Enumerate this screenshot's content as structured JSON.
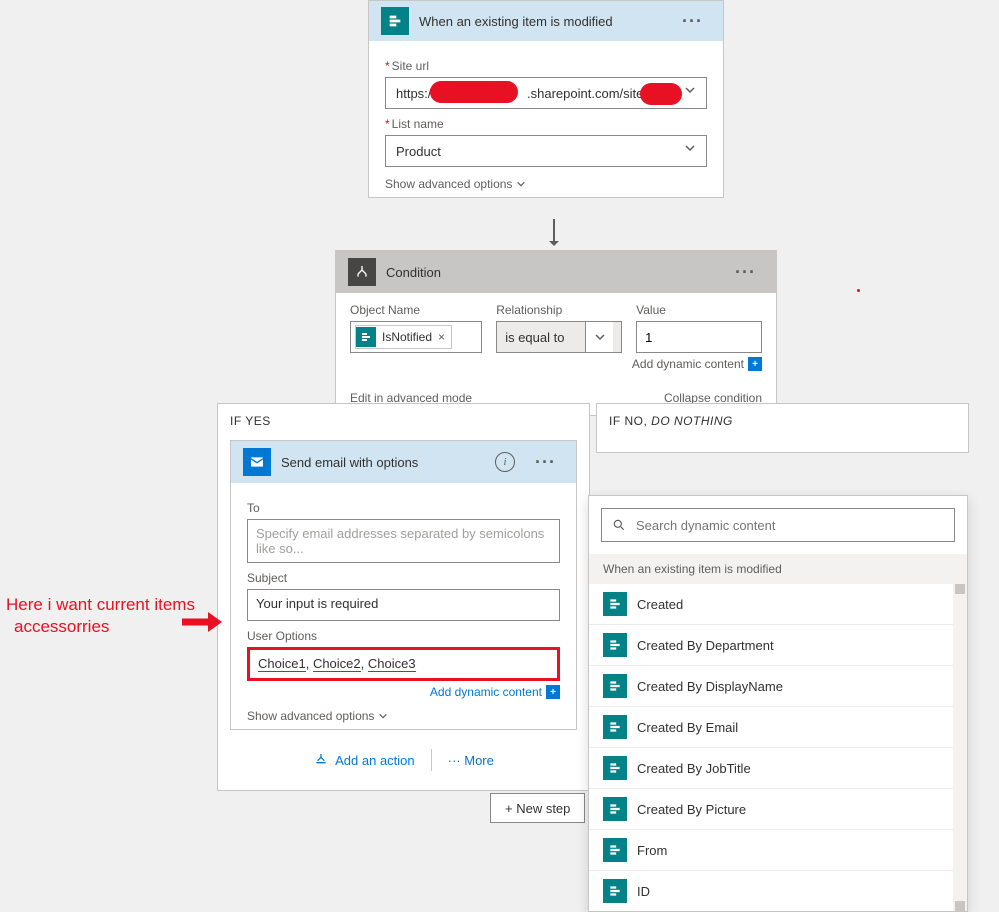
{
  "trigger": {
    "title": "When an existing item is modified",
    "siteLabel": "Site url",
    "siteValue_pre": "https://",
    "siteValue_post": ".sharepoint.com/sites/",
    "listLabel": "List name",
    "listValue": "Product",
    "advanced": "Show advanced options"
  },
  "condition": {
    "title": "Condition",
    "col1": "Object Name",
    "col2": "Relationship",
    "col3": "Value",
    "pill": "IsNotified",
    "relationship": "is equal to",
    "value": "1",
    "addDynamic": "Add dynamic content",
    "editAdv": "Edit in advanced mode",
    "collapse": "Collapse condition"
  },
  "branches": {
    "yesLabel": "IF YES",
    "noLabelPre": "IF NO, ",
    "noLabelEm": "DO NOTHING"
  },
  "email": {
    "title": "Send email with options",
    "toLabel": "To",
    "toPlaceholder": "Specify email addresses separated by semicolons like so...",
    "subjectLabel": "Subject",
    "subjectValue": "Your input is required",
    "optLabel": "User Options",
    "opt1": "Choice1",
    "opt2": "Choice2",
    "opt3": "Choice3",
    "addDynamic": "Add dynamic content",
    "advanced": "Show advanced options"
  },
  "actions": {
    "add": "Add an action",
    "more": "More"
  },
  "dynPanel": {
    "searchPlaceholder": "Search dynamic content",
    "sectionTitle": "When an existing item is modified",
    "items": [
      "Created",
      "Created By Department",
      "Created By DisplayName",
      "Created By Email",
      "Created By JobTitle",
      "Created By Picture",
      "From",
      "ID"
    ]
  },
  "newStep": "+ New step",
  "annotation": {
    "l1": "Here i want current items",
    "l2": "accessorries"
  }
}
